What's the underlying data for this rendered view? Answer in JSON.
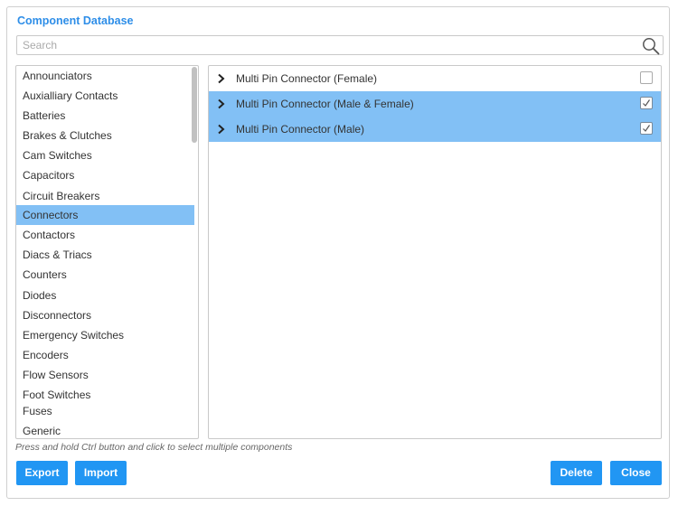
{
  "dialog": {
    "title": "Component Database"
  },
  "search": {
    "placeholder": "Search",
    "value": ""
  },
  "categories": [
    {
      "label": "Announciators",
      "selected": false
    },
    {
      "label": "Auxialliary Contacts",
      "selected": false
    },
    {
      "label": "Batteries",
      "selected": false
    },
    {
      "label": "Brakes & Clutches",
      "selected": false
    },
    {
      "label": "Cam Switches",
      "selected": false
    },
    {
      "label": "Capacitors",
      "selected": false
    },
    {
      "label": "Circuit Breakers",
      "selected": false
    },
    {
      "label": "Connectors",
      "selected": true
    },
    {
      "label": "Contactors",
      "selected": false
    },
    {
      "label": "Diacs & Triacs",
      "selected": false
    },
    {
      "label": "Counters",
      "selected": false
    },
    {
      "label": "Diodes",
      "selected": false
    },
    {
      "label": "Disconnectors",
      "selected": false
    },
    {
      "label": "Emergency Switches",
      "selected": false
    },
    {
      "label": "Encoders",
      "selected": false
    },
    {
      "label": "Flow Sensors",
      "selected": false
    },
    {
      "label": "Foot Switches",
      "selected": false
    },
    {
      "label": "Fuses",
      "selected": false
    },
    {
      "label": "Generic",
      "selected": false
    }
  ],
  "components": [
    {
      "label": "Multi Pin Connector (Female)",
      "checked": false,
      "selected": false
    },
    {
      "label": "Multi Pin Connector (Male & Female)",
      "checked": true,
      "selected": true
    },
    {
      "label": "Multi Pin Connector (Male)",
      "checked": true,
      "selected": true
    }
  ],
  "hint": "Press and hold Ctrl button and click to select multiple components",
  "buttons": {
    "export": "Export",
    "import": "Import",
    "delete": "Delete",
    "close": "Close"
  },
  "colors": {
    "accent": "#2196f3",
    "title": "#2e8ee8",
    "selection": "#82c0f5"
  }
}
